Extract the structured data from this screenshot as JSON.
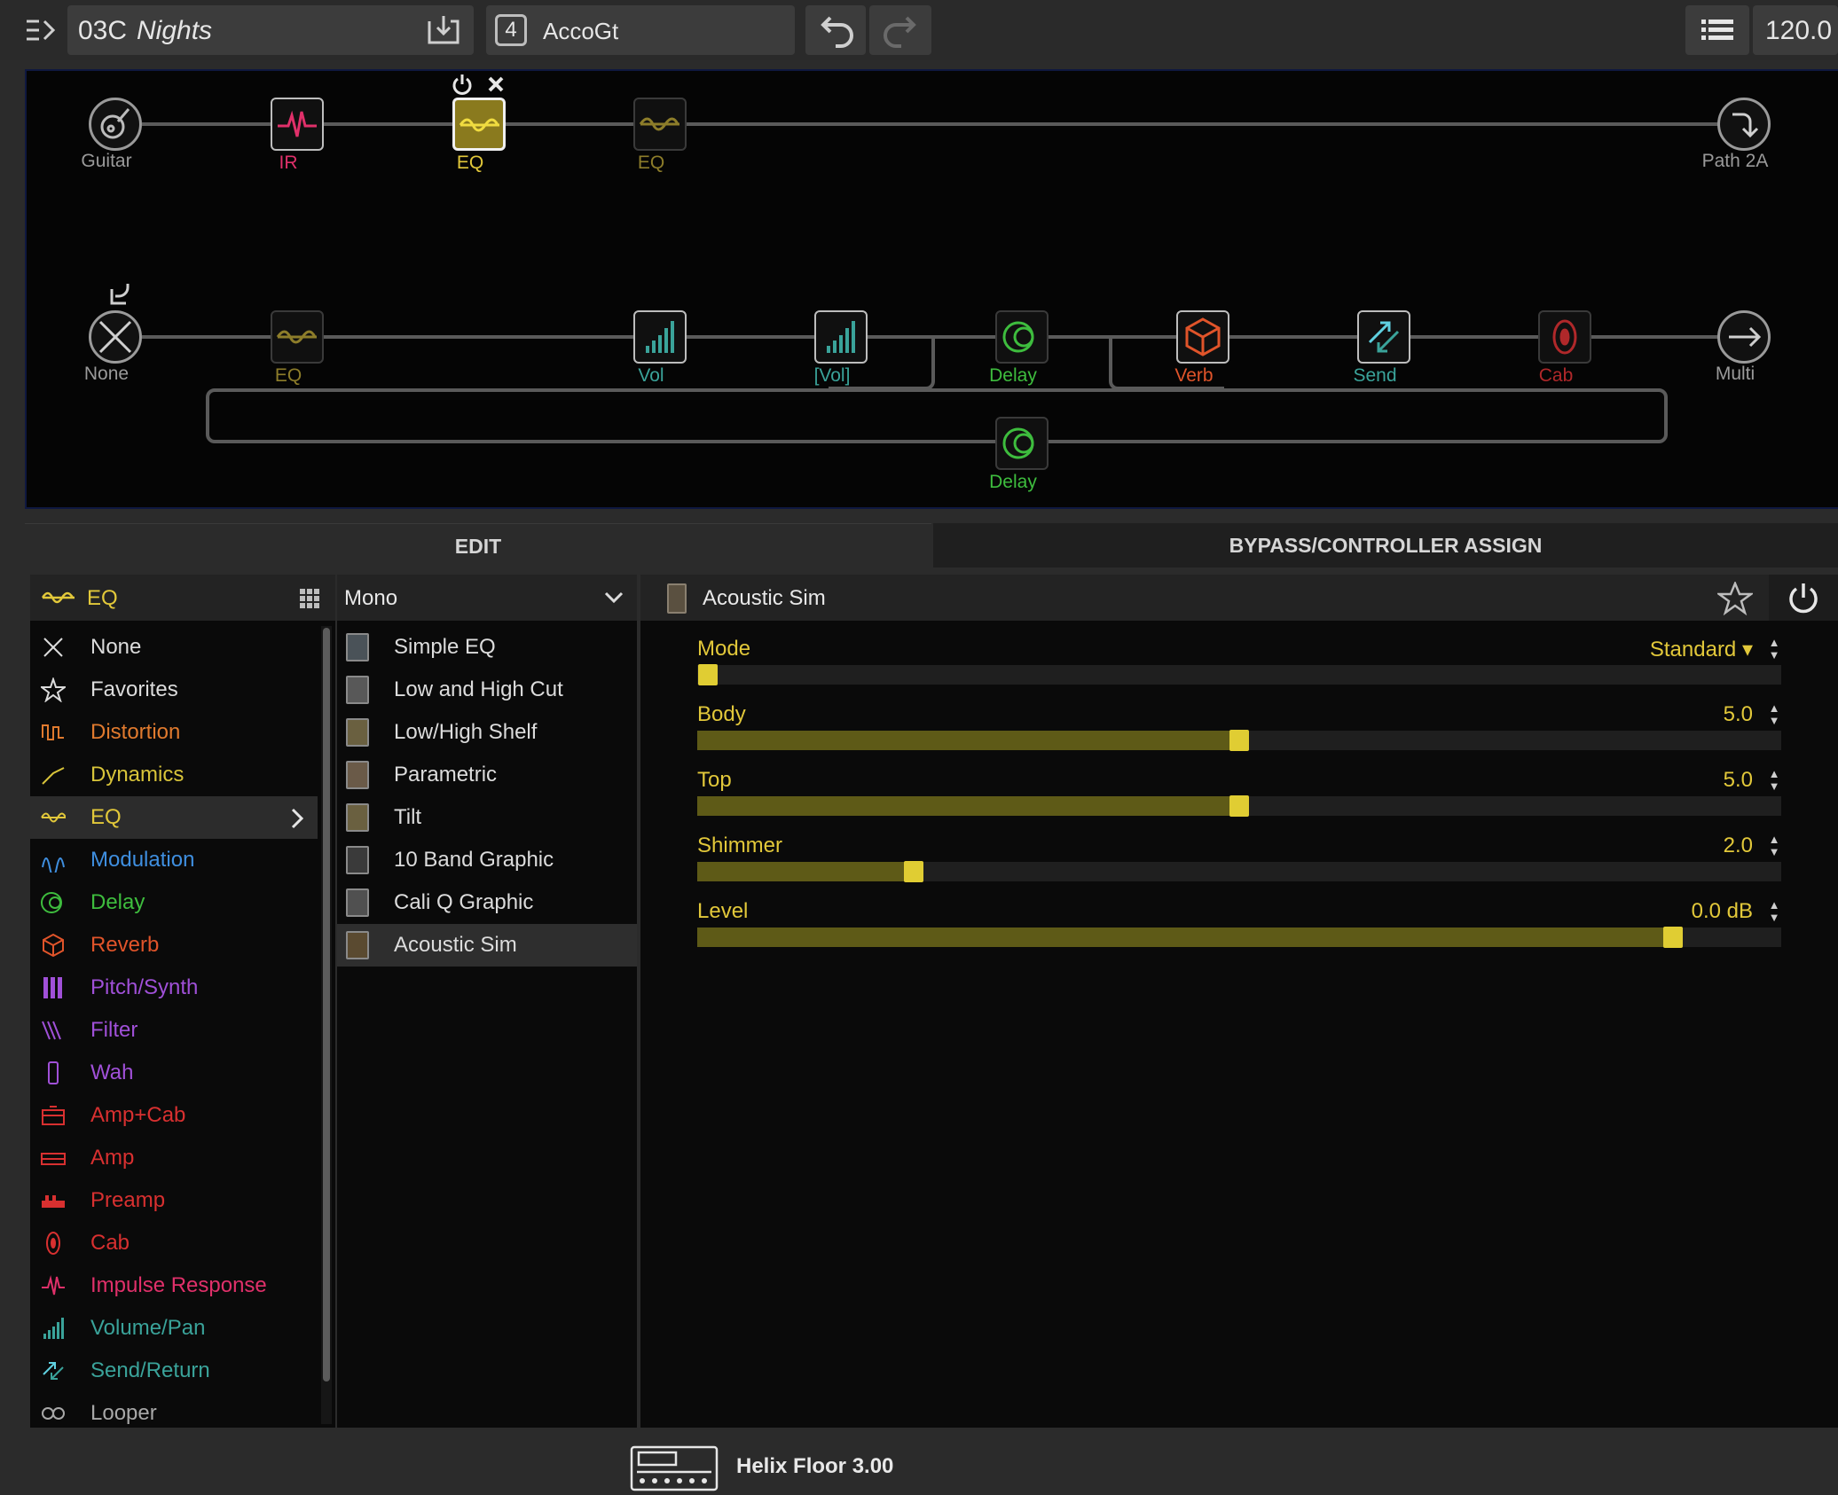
{
  "topbar": {
    "preset_number": "03C",
    "preset_name": "Nights",
    "snapshot_number": "4",
    "snapshot_name": "AccoGt",
    "tempo": "120.0"
  },
  "flow": {
    "path1": [
      {
        "label": "Guitar",
        "color": "#9a9a9a"
      },
      {
        "label": "IR",
        "color": "#e0306a"
      },
      {
        "label": "EQ",
        "color": "#e2c83a"
      },
      {
        "label": "EQ",
        "color": "#8d7d2a"
      },
      {
        "label": "Path 2A",
        "color": "#9a9a9a"
      }
    ],
    "path2": [
      {
        "label": "None",
        "color": "#9a9a9a"
      },
      {
        "label": "EQ",
        "color": "#8d7d2a"
      },
      {
        "label": "Vol",
        "color": "#3aa39a"
      },
      {
        "label": "[Vol]",
        "color": "#3aa39a"
      },
      {
        "label": "Delay",
        "color": "#3ebd3e"
      },
      {
        "label": "Verb",
        "color": "#e0542a"
      },
      {
        "label": "Send",
        "color": "#3aa39a"
      },
      {
        "label": "Cab",
        "color": "#b0282a"
      },
      {
        "label": "Multi",
        "color": "#9a9a9a"
      },
      {
        "label": "Delay",
        "color": "#3ebd3e"
      }
    ]
  },
  "tabs": {
    "edit": "EDIT",
    "bypass": "BYPASS/CONTROLLER ASSIGN"
  },
  "category_panel": {
    "title": "EQ",
    "items": [
      {
        "label": "None",
        "color": "#dcdcdc",
        "icon": "x-icon"
      },
      {
        "label": "Favorites",
        "color": "#dcdcdc",
        "icon": "star-icon"
      },
      {
        "label": "Distortion",
        "color": "#e07a2e",
        "icon": "distortion-icon"
      },
      {
        "label": "Dynamics",
        "color": "#d8c43a",
        "icon": "dynamics-icon"
      },
      {
        "label": "EQ",
        "color": "#e2c83a",
        "icon": "eq-icon"
      },
      {
        "label": "Modulation",
        "color": "#3f8fe0",
        "icon": "modulation-icon"
      },
      {
        "label": "Delay",
        "color": "#3ebd3e",
        "icon": "delay-icon"
      },
      {
        "label": "Reverb",
        "color": "#e0542a",
        "icon": "reverb-icon"
      },
      {
        "label": "Pitch/Synth",
        "color": "#a050d8",
        "icon": "pitch-icon"
      },
      {
        "label": "Filter",
        "color": "#a050d8",
        "icon": "filter-icon"
      },
      {
        "label": "Wah",
        "color": "#a050d8",
        "icon": "wah-icon"
      },
      {
        "label": "Amp+Cab",
        "color": "#d83030",
        "icon": "ampcab-icon"
      },
      {
        "label": "Amp",
        "color": "#d83030",
        "icon": "amp-icon"
      },
      {
        "label": "Preamp",
        "color": "#d83030",
        "icon": "preamp-icon"
      },
      {
        "label": "Cab",
        "color": "#d83030",
        "icon": "cab-icon"
      },
      {
        "label": "Impulse Response",
        "color": "#e0306a",
        "icon": "ir-icon"
      },
      {
        "label": "Volume/Pan",
        "color": "#3aa39a",
        "icon": "volume-icon"
      },
      {
        "label": "Send/Return",
        "color": "#3aa39a",
        "icon": "send-icon"
      },
      {
        "label": "Looper",
        "color": "#a8a8a8",
        "icon": "looper-icon"
      }
    ]
  },
  "model_panel": {
    "title": "Mono",
    "items": [
      "Simple EQ",
      "Low and High Cut",
      "Low/High Shelf",
      "Parametric",
      "Tilt",
      "10 Band Graphic",
      "Cali Q Graphic",
      "Acoustic Sim"
    ]
  },
  "params_panel": {
    "title": "Acoustic Sim",
    "params": [
      {
        "name": "Mode",
        "value": "Standard ▾",
        "level": 0.01
      },
      {
        "name": "Body",
        "value": "5.0",
        "level": 0.5
      },
      {
        "name": "Top",
        "value": "5.0",
        "level": 0.5
      },
      {
        "name": "Shimmer",
        "value": "2.0",
        "level": 0.2
      },
      {
        "name": "Level",
        "value": "0.0 dB",
        "level": 0.9
      }
    ]
  },
  "status": {
    "device": "Helix Floor 3.00"
  }
}
